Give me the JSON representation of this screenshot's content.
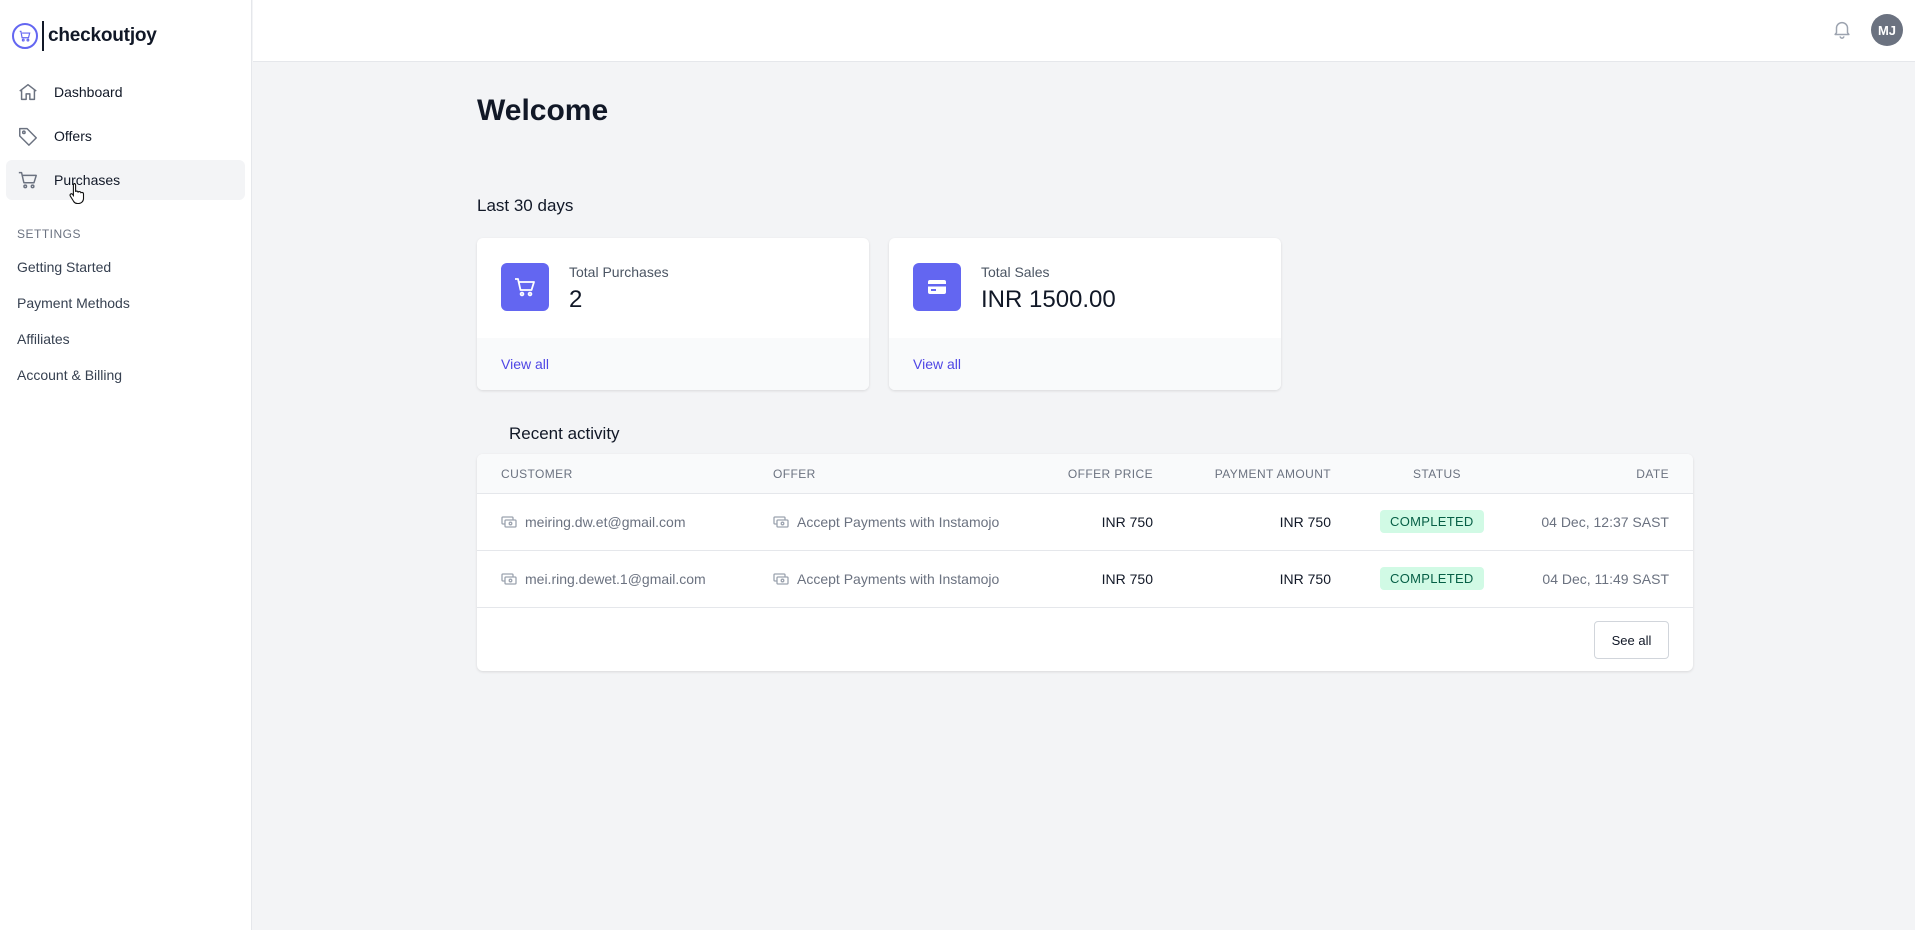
{
  "brand": {
    "name": "checkoutjoy"
  },
  "nav": {
    "items": [
      {
        "label": "Dashboard",
        "icon": "home-icon"
      },
      {
        "label": "Offers",
        "icon": "tag-icon"
      },
      {
        "label": "Purchases",
        "icon": "cart-icon",
        "active": true
      }
    ]
  },
  "settings": {
    "heading": "SETTINGS",
    "items": [
      "Getting Started",
      "Payment Methods",
      "Affiliates",
      "Account & Billing"
    ]
  },
  "header": {
    "bell_icon": "bell-icon",
    "avatar_initials": "MJ"
  },
  "main": {
    "title": "Welcome",
    "period": "Last 30 days",
    "stats": [
      {
        "label": "Total Purchases",
        "value": "2",
        "link": "View all",
        "icon": "cart-icon"
      },
      {
        "label": "Total Sales",
        "value": "INR 1500.00",
        "link": "View all",
        "icon": "credit-card-icon"
      }
    ],
    "recent": {
      "title": "Recent activity",
      "columns": [
        "CUSTOMER",
        "OFFER",
        "OFFER PRICE",
        "PAYMENT AMOUNT",
        "STATUS",
        "DATE"
      ],
      "rows": [
        {
          "customer": "meiring.dw.et@gmail.com",
          "offer": "Accept Payments with Instamojo",
          "offer_price": "INR 750",
          "payment_amount": "INR 750",
          "status": "COMPLETED",
          "date": "04 Dec, 12:37 SAST"
        },
        {
          "customer": "mei.ring.dewet.1@gmail.com",
          "offer": "Accept Payments with Instamojo",
          "offer_price": "INR 750",
          "payment_amount": "INR 750",
          "status": "COMPLETED",
          "date": "04 Dec, 11:49 SAST"
        }
      ],
      "see_all": "See all"
    }
  },
  "colors": {
    "accent": "#6366f1",
    "link": "#4f46e5",
    "status_bg": "#d1fae5",
    "status_text": "#065f46"
  }
}
